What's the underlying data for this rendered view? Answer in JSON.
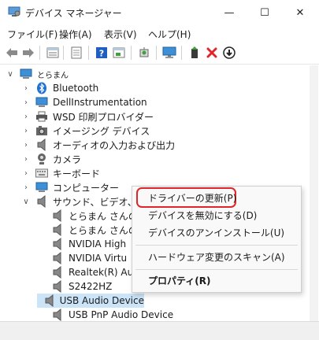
{
  "window": {
    "title": "デバイス マネージャー",
    "minimize": "—",
    "maximize": "☐",
    "close": "✕"
  },
  "menu": [
    {
      "label": "ファイル(F)"
    },
    {
      "label": "操作(A)"
    },
    {
      "label": "表示(V)"
    },
    {
      "label": "ヘルプ(H)"
    }
  ],
  "tree": {
    "root": "とらまん",
    "categories": [
      {
        "label": "Bluetooth",
        "icon": "bluetooth-icon"
      },
      {
        "label": "DellInstrumentation",
        "icon": "monitor-icon"
      },
      {
        "label": "WSD 印刷プロバイダー",
        "icon": "printer-icon"
      },
      {
        "label": "イメージング デバイス",
        "icon": "camera-device-icon"
      },
      {
        "label": "オーディオの入力および出力",
        "icon": "speaker-icon"
      },
      {
        "label": "カメラ",
        "icon": "webcam-icon"
      },
      {
        "label": "キーボード",
        "icon": "keyboard-icon"
      },
      {
        "label": "コンピューター",
        "icon": "computer-icon"
      },
      {
        "label": "サウンド、ビデオ、お",
        "icon": "speaker-icon"
      }
    ],
    "sound_children": [
      {
        "label": "とらまん さんの"
      },
      {
        "label": "とらまん さんの"
      },
      {
        "label": "NVIDIA High"
      },
      {
        "label": "NVIDIA Virtu"
      },
      {
        "label": "Realtek(R) Au"
      },
      {
        "label": "S2422HZ"
      },
      {
        "label": "USB Audio Device"
      },
      {
        "label": "USB PnP Audio Device"
      }
    ]
  },
  "context_menu": {
    "items": [
      {
        "label": "ドライバーの更新(P)"
      },
      {
        "label": "デバイスを無効にする(D)"
      },
      {
        "label": "デバイスのアンインストール(U)"
      },
      {
        "label": "ハードウェア変更のスキャン(A)"
      },
      {
        "label": "プロパティ(R)"
      }
    ],
    "highlight_color": "#e0262b"
  },
  "colors": {
    "selection": "#cce4f7",
    "accent": "#0078d4"
  }
}
